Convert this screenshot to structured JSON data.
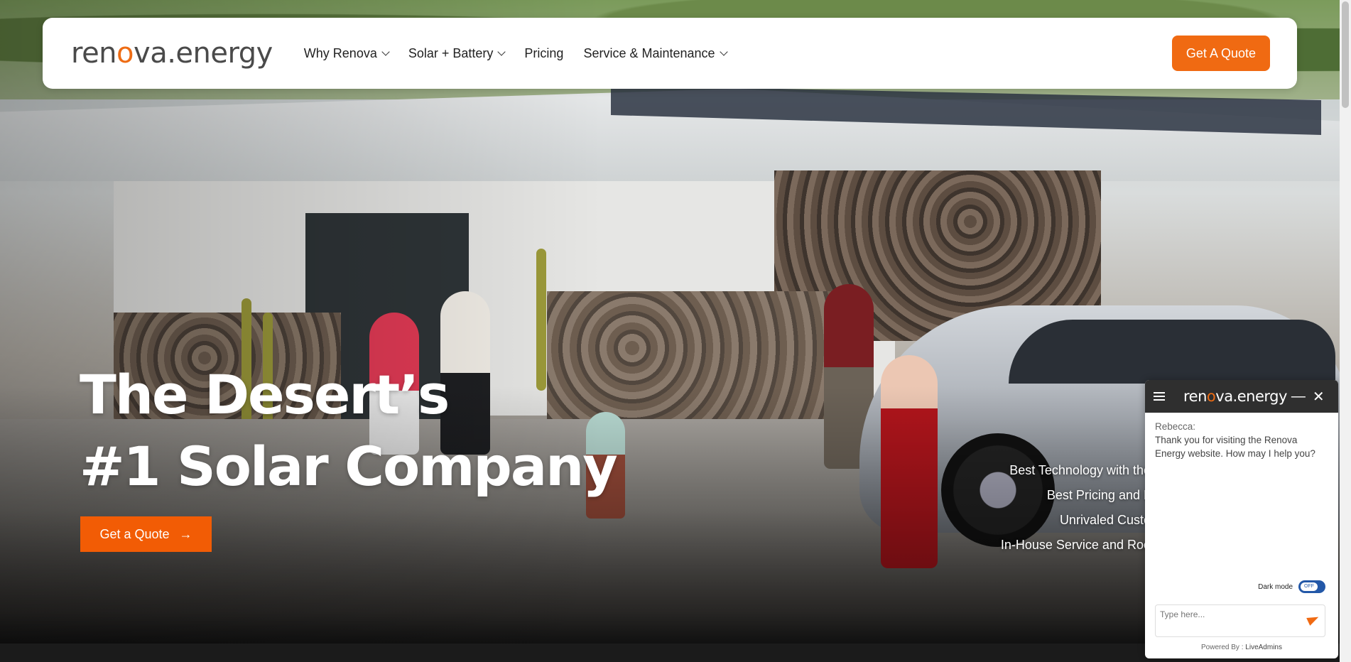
{
  "header": {
    "logo": {
      "part1": "ren",
      "accent": "o",
      "part2": "va.energy"
    },
    "nav": [
      {
        "label": "Why Renova",
        "dropdown": true
      },
      {
        "label": "Solar + Battery",
        "dropdown": true
      },
      {
        "label": "Pricing",
        "dropdown": false
      },
      {
        "label": "Service & Maintenance",
        "dropdown": true
      }
    ],
    "cta_label": "Get A Quote"
  },
  "hero": {
    "headline_line1": "The Desert’s",
    "headline_line2": "#1 Solar Company",
    "cta_label": "Get a Quote",
    "cta_arrow": "→",
    "features": [
      "Best Technology with the",
      "Best Pricing and L",
      "Unrivaled Custo",
      "In-House Service and Roo"
    ]
  },
  "chat": {
    "logo": {
      "part1": "ren",
      "accent": "o",
      "part2": "va.energy"
    },
    "minimize": "—",
    "close": "✕",
    "agent": "Rebecca:",
    "message": "Thank you for visiting the Renova Energy website. How may I help you?",
    "dark_mode_label": "Dark mode",
    "dark_mode_state": "OFF",
    "input_placeholder": "Type here...",
    "powered_prefix": "Powered By :",
    "powered_brand": "LiveAdmins"
  },
  "colors": {
    "brand_orange": "#f06a12",
    "chat_header": "#2f2f2f",
    "toggle_blue": "#2358a8"
  }
}
